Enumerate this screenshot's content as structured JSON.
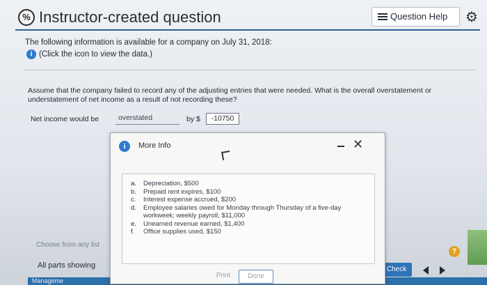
{
  "header": {
    "title": "Instructor-created question",
    "icon_label": "%",
    "help_label": "Question Help"
  },
  "intro": {
    "text": "The following information is available for a company on July 31, 2018:",
    "data_link": "(Click the icon to view the data.)"
  },
  "question": {
    "text": "Assume that the company failed to record any of the adjusting entries that were needed. What is the overall overstatement or understatement of net income as a result of not recording these?",
    "answer_label": "Net income would be",
    "selected": "overstated",
    "by_label": "by $",
    "amount": "-10750"
  },
  "footer": {
    "choose_text": "Choose from any list",
    "parts_text": "All parts showing",
    "bar_text": "Manageme",
    "final_check": "nal Check"
  },
  "modal": {
    "title": "More Info",
    "items": [
      {
        "letter": "a.",
        "text": "Depreciation, $500"
      },
      {
        "letter": "b.",
        "text": "Prepaid rent expires, $100"
      },
      {
        "letter": "c.",
        "text": "Interest expense accrued, $200"
      },
      {
        "letter": "d.",
        "text": "Employee salaries owed for Monday through Thursday of a five-day workweek; weekly payroll, $11,000"
      },
      {
        "letter": "e.",
        "text": "Unearned revenue earned, $1,400"
      },
      {
        "letter": "f.",
        "text": "Office supplies used, $150"
      }
    ],
    "print_label": "Print",
    "done_label": "Done"
  },
  "colors": {
    "accent": "#2f72b8",
    "info": "#2f7ad0",
    "help": "#e0a21f"
  }
}
